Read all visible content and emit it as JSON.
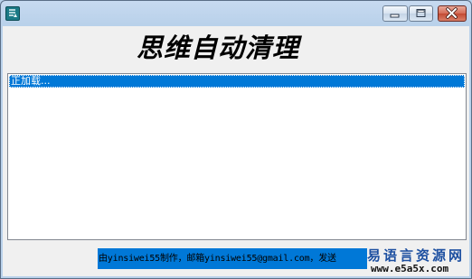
{
  "window": {
    "heading": "思维自动清理"
  },
  "list": {
    "items": [
      "正加载..."
    ]
  },
  "footer": {
    "credit": "由yinsiwei55制作，邮箱yinsiwei55@gmail.com，发送"
  },
  "watermark": {
    "text": "易语言资源网",
    "url": "www.e5a5x.com"
  },
  "icons": {
    "app": "app-icon",
    "minimize": "minimize-icon",
    "maximize": "maximize-icon",
    "close": "close-icon"
  },
  "colors": {
    "selection": "#0078d7",
    "close_button": "#c34a33",
    "client_background": "#f0f0f0",
    "watermark_text": "#1c4fa0"
  }
}
